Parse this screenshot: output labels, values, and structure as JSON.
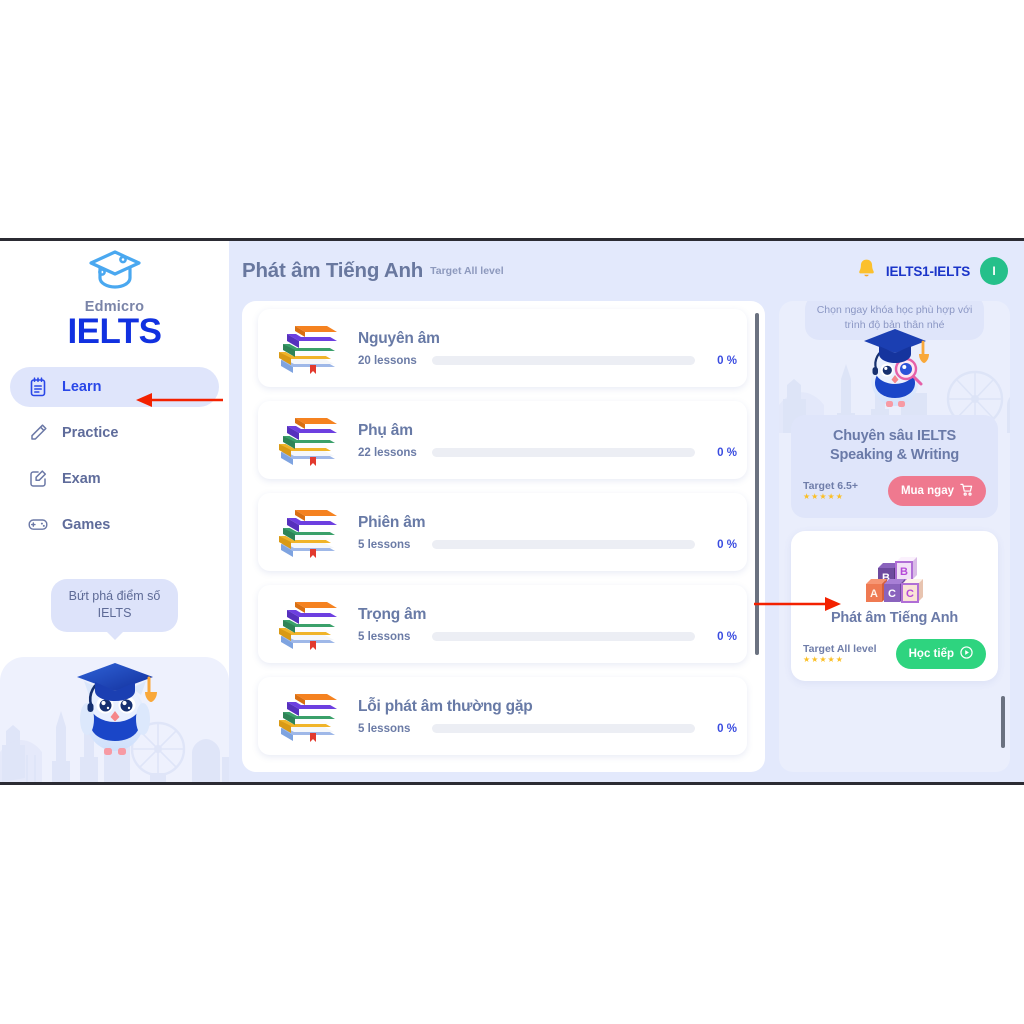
{
  "sidebar": {
    "brand_sub": "Edmicro",
    "brand_title": "IELTS",
    "logo_icon": "graduation-cap-icon",
    "items": [
      {
        "label": "Learn",
        "icon": "notepad-icon",
        "active": true
      },
      {
        "label": "Practice",
        "icon": "pencil-icon",
        "active": false
      },
      {
        "label": "Exam",
        "icon": "edit-doc-icon",
        "active": false
      },
      {
        "label": "Games",
        "icon": "gamepad-icon",
        "active": false
      }
    ],
    "bubble_line1": "Bứt phá điểm số",
    "bubble_line2": "IELTS",
    "mascot_icon": "owl-graduate-mascot"
  },
  "header": {
    "title": "Phát âm Tiếng Anh",
    "subtitle": "Target All level",
    "bell_icon": "bell-icon",
    "user_name": "IELTS1-IELTS",
    "avatar_initial": "I"
  },
  "lessons": [
    {
      "name": "Nguyên âm",
      "count": "20 lessons",
      "percent": "0 %",
      "progress": 0,
      "icon": "books-stack-icon"
    },
    {
      "name": "Phụ âm",
      "count": "22 lessons",
      "percent": "0 %",
      "progress": 0,
      "icon": "books-stack-icon"
    },
    {
      "name": "Phiên âm",
      "count": "5 lessons",
      "percent": "0 %",
      "progress": 0,
      "icon": "books-stack-icon"
    },
    {
      "name": "Trọng âm",
      "count": "5 lessons",
      "percent": "0 %",
      "progress": 0,
      "icon": "books-stack-icon"
    },
    {
      "name": "Lỗi phát âm thường gặp",
      "count": "5 lessons",
      "percent": "0 %",
      "progress": 0,
      "icon": "books-stack-icon"
    }
  ],
  "rail": {
    "caption": "Chọn ngay khóa học phù hợp với trình độ bản thân nhé",
    "cards": [
      {
        "title": "Chuyên sâu IELTS Speaking & Writing",
        "target": "Target 6.5+",
        "stars": "★★★★★",
        "button_label": "Mua ngay",
        "button_icon": "cart-icon"
      },
      {
        "title": "Phát âm Tiếng Anh",
        "target": "Target All level",
        "stars": "★★★★★",
        "button_label": "Học tiếp",
        "button_icon": "play-circle-icon",
        "thumb_icon": "abc-blocks-icon"
      }
    ]
  },
  "colors": {
    "brand_blue": "#1131e0",
    "accent_blue": "#2947e8",
    "page_bg": "#e3e9fc",
    "rail_bg": "#eaeefc",
    "avatar_green": "#25c08a",
    "btn_pink": "#ef798f",
    "btn_green": "#2ed47f",
    "annotation_red": "#f32100",
    "star_gold": "#fbbf24"
  }
}
